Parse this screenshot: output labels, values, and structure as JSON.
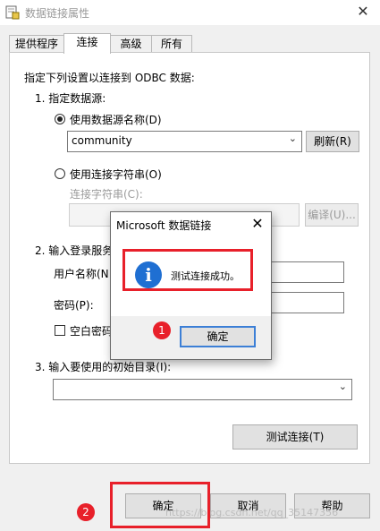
{
  "window": {
    "title": "数据链接属性",
    "close_glyph": "✕"
  },
  "tabs": [
    {
      "label": "提供程序",
      "active": false
    },
    {
      "label": "连接",
      "active": true
    },
    {
      "label": "高级",
      "active": false
    },
    {
      "label": "所有",
      "active": false
    }
  ],
  "connection": {
    "instruction": "指定下列设置以连接到 ODBC 数据:",
    "step1": "1. 指定数据源:",
    "use_dsn_label": "使用数据源名称(D)",
    "dsn_value": "community",
    "refresh_button": "刷新(R)",
    "use_connstr_label": "使用连接字符串(O)",
    "connstr_label": "连接字符串(C):",
    "build_button": "编译(U)...",
    "step2": "2. 输入登录服务",
    "username_label": "用户名称(N",
    "password_label": "密码(P):",
    "blank_password_label": "空白密码",
    "step3": "3. 输入要使用的初始目录(I):",
    "test_button": "测试连接(T)"
  },
  "footer": {
    "ok_button": "确定",
    "cancel_button": "取消",
    "help_button": "帮助"
  },
  "dialog": {
    "title": "Microsoft 数据链接",
    "message": "测试连接成功。",
    "ok_button": "确定",
    "close_glyph": "✕",
    "icon_glyph": "i"
  },
  "annotations": {
    "badge1": "1",
    "badge2": "2"
  },
  "watermark": "https://blog.csdn.net/qq_35147356",
  "colors": {
    "highlight_red": "#e8202a",
    "info_blue": "#1f6fd2"
  }
}
